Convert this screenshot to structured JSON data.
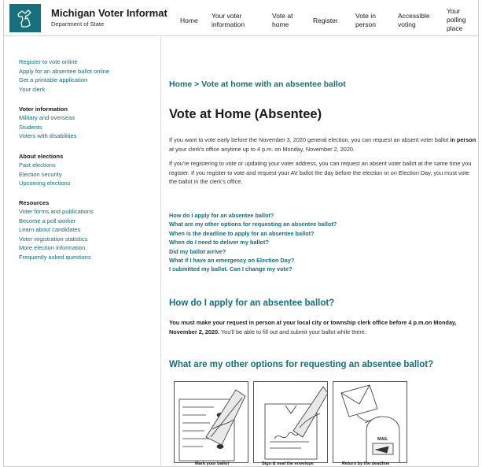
{
  "header": {
    "site_title": "Michigan Voter Informatic",
    "site_subtitle": "Department of State",
    "nav": {
      "home": "Home",
      "voter_info_1": "Your voter",
      "voter_info_2": "information",
      "vote_home_1": "Vote at",
      "vote_home_2": "home",
      "register": "Register",
      "vote_person_1": "Vote in",
      "vote_person_2": "person",
      "accessible_1": "Accessible",
      "accessible_2": "voting",
      "polling_1": "Your",
      "polling_2": "polling",
      "polling_3": "place"
    }
  },
  "sidebar": {
    "top_links": [
      "Register to vote online",
      "Apply for an absentee ballot online",
      "Get a printable application",
      "Your clerk"
    ],
    "voter_info": {
      "heading": "Voter information",
      "links": [
        "Military and overseas",
        "Students",
        "Voters with disabilities"
      ]
    },
    "about": {
      "heading": "About elections",
      "links": [
        "Past elections",
        "Election security",
        "Upcoming elections"
      ]
    },
    "resources": {
      "heading": "Resources",
      "links": [
        "Voter forms and publications",
        "Become a poll worker",
        "Learn about candidates",
        "Voter registration statistics",
        "More election information",
        "Frequently asked questions"
      ]
    }
  },
  "main": {
    "breadcrumb": "Home > Vote at home with an absentee ballot",
    "title": "Vote at Home (Absentee)",
    "para1_a": "If you want to vote early before the November 3, 2020 general election, you can request an absent voter ballot ",
    "para1_b": "in person",
    "para1_c": " at your clerk's office anytime up to 4 p.m. on Monday, November 2, 2020.",
    "para2": "If you're registering to vote or updating your voter address, you can request an absent voter ballot at the same time you register. If you register to vote and request your AV ballot the day before the election or on Election Day, you must vote the ballot in the clerk's office.",
    "faq": [
      "How do I apply for an absentee ballot?",
      "What are my other options for requesting an absentee ballot?",
      "When is the deadline to apply for an absentee ballot?",
      "When do I need to deliver my ballot?",
      "Did my ballot arrive?",
      "What if I have an emergency on Election Day?",
      "I submitted my ballot. Can I change my vote?"
    ],
    "section1_title": "How do I apply for an absentee ballot?",
    "section1_bold": "You must make your request in person at your local city or township clerk office before 4 p.m.on Monday, November 2, 2020.",
    "section1_rest": " You'll be able to fill out and submit your ballot while there.",
    "section2_title": "What are my other options for requesting an absentee ballot?",
    "steps": [
      "Mark your ballot",
      "Sign & seal the envelope",
      "Return by the deadline"
    ],
    "mailbox_label": "MAIL"
  },
  "colors": {
    "brand_teal": "#19707d",
    "link_teal": "#14707e"
  }
}
